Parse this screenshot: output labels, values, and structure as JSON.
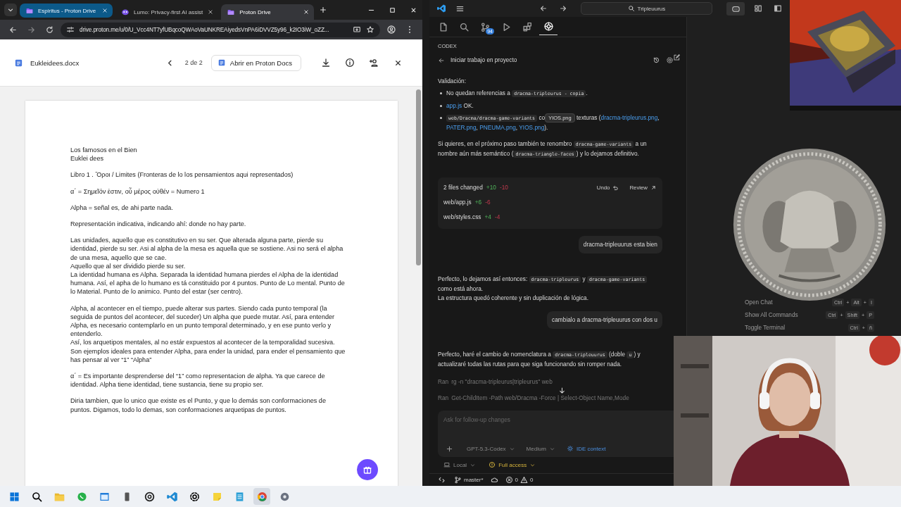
{
  "browser": {
    "tabs": [
      {
        "title": "Espiritus - Proton Drive",
        "selected": false,
        "hovered": true
      },
      {
        "title": "Lumo: Privacy-first AI assist",
        "selected": false,
        "hovered": false
      },
      {
        "title": "Proton Drive",
        "selected": true,
        "hovered": false
      }
    ],
    "address": "drive.proton.me/u/0/U_Vcc4NT7yfUBqcoQWAoVaUNKREAiyedsVnPA6iDVVZ5y96_k2IO3iW_oZZ...",
    "viewer": {
      "file_name": "Eukleidees.docx",
      "page_counter": "2 de 2",
      "open_button": "Abrir en Proton Docs"
    },
    "document": [
      [
        "Los famosos en el Bien",
        "Euklei dees"
      ],
      [
        "Libro 1 . Ὅροι / Limites (Fronteras de lo los pensamientos aqui representados)"
      ],
      [
        "α΄ = Σημεῖόν ἐστιν, οὗ μέρος οὐθέν = Numero 1"
      ],
      [
        "Alpha = señal es, de ahi parte nada."
      ],
      [
        "Representación indicativa, indicando ahí: donde no hay parte."
      ],
      [
        "Las unidades, aquello que es constitutivo en su ser. Que alterada alguna parte, pierde su identidad, pierde su ser. Asi al alpha de la mesa es aquella que se sostiene. Asi no será el alpha de una mesa, aquello que se cae.",
        "Aquello que al ser dividido pierde su ser.",
        "La identidad humana es Alpha. Separada la identidad humana pierdes el Alpha de la identidad humana. Así, el apha de lo humano es tá constituido por 4 puntos. Punto de Lo mental. Punto de lo Material. Punto de lo animico. Punto del estar (ser centro)."
      ],
      [
        "Alpha, al acontecer en el tiempo, puede alterar sus partes. Siendo cada punto temporal (la seguida de puntos del acontecer, del suceder) Un alpha que puede mutar. Así, para entender Alpha, es necesario contemplarlo en un punto temporal determinado, y en ese punto verlo y entenderlo.",
        "Así, los arquetipos mentales, al no estár expuestos al acontecer de la temporalidad sucesiva. Son ejemplos ideales para entender Alpha, para ender la unidad, para ender el pensamiento que has pensar al ver “1” “Alpha”"
      ],
      [
        "α΄ = Es importante desprenderse del “1” como representacion de alpha. Ya que carece de identidad. Alpha tiene identidad, tiene sustancia, tiene su propio ser."
      ],
      [
        "Diria tambien, que lo unico que existe es el Punto, y que lo demás son conformaciones de puntos. Digamos, todo lo demas, son conformaciones arquetipas de puntos."
      ]
    ]
  },
  "editor": {
    "search": "Tripleuurus",
    "activity": [
      {
        "selected": false
      },
      {
        "selected": false
      },
      {
        "selected": false,
        "badge": "94"
      },
      {
        "selected": false
      },
      {
        "selected": false
      },
      {
        "selected": true
      }
    ],
    "panel_title": "CODEX",
    "thread_title": "Iniciar trabajo en proyecto",
    "thread": [
      {
        "kind": "heading",
        "text": "Validación:"
      },
      {
        "kind": "bullets",
        "items": [
          [
            {
              "kind": "text",
              "text": "No quedan referencias a "
            },
            {
              "kind": "code",
              "text": "dracma-tripleurus - copia"
            },
            {
              "kind": "text",
              "text": "."
            }
          ],
          [
            {
              "kind": "link",
              "text": "app.js"
            },
            {
              "kind": "text",
              "text": " OK."
            }
          ],
          [
            {
              "kind": "code",
              "text": "web/Dracma/dracma-game-variants"
            },
            {
              "kind": "text",
              "text": " co"
            },
            {
              "kind": "tooltip",
              "text": "YIOS.png"
            },
            {
              "kind": "text",
              "text": " texturas ("
            },
            {
              "kind": "link",
              "text": "dracma-tripleurus.png"
            },
            {
              "kind": "text",
              "text": ", "
            },
            {
              "kind": "link",
              "text": "PATER.png"
            },
            {
              "kind": "text",
              "text": ", "
            },
            {
              "kind": "link",
              "text": "PNEUMA.png"
            },
            {
              "kind": "text",
              "text": ", "
            },
            {
              "kind": "link",
              "text": "YIOS.png"
            },
            {
              "kind": "text",
              "text": ")."
            }
          ]
        ]
      },
      {
        "kind": "paragraph",
        "lines": [
          [
            {
              "kind": "text",
              "text": "Si quieres, en el próximo paso también te renombro "
            },
            {
              "kind": "code",
              "text": "dracma-game-variants"
            },
            {
              "kind": "text",
              "text": " a un nombre aún más semántico ("
            },
            {
              "kind": "code",
              "text": "dracma-triangle-faces"
            },
            {
              "kind": "text",
              "text": ") y lo dejamos definitivo."
            }
          ]
        ]
      },
      {
        "kind": "changes",
        "summary": "2 files changed",
        "added": "+10",
        "removed": "-10",
        "undo": "Undo",
        "review": "Review",
        "files": [
          {
            "path": "web/app.js",
            "added": "+6",
            "removed": "-6"
          },
          {
            "path": "web/styles.css",
            "added": "+4",
            "removed": "-4"
          }
        ]
      },
      {
        "kind": "user",
        "text": "dracma-tripleuurus esta bien"
      },
      {
        "kind": "paragraph",
        "lines": [
          [
            {
              "kind": "text",
              "text": "Perfecto, lo dejamos así entonces: "
            },
            {
              "kind": "code",
              "text": "dracma-tripleurus"
            },
            {
              "kind": "text",
              "text": " y "
            },
            {
              "kind": "code",
              "text": "dracma-game-variants"
            },
            {
              "kind": "text",
              "text": " como está ahora."
            }
          ],
          [
            {
              "kind": "text",
              "text": "La estructura quedó coherente y sin duplicación de lógica."
            }
          ]
        ]
      },
      {
        "kind": "user",
        "text": "cambialo a dracma-tripleuurus con dos u"
      },
      {
        "kind": "paragraph",
        "lines": [
          [
            {
              "kind": "text",
              "text": "Perfecto, haré el cambio de nomenclatura a "
            },
            {
              "kind": "code",
              "text": "dracma-tripleuurus"
            },
            {
              "kind": "text",
              "text": " (doble "
            },
            {
              "kind": "code",
              "text": "u"
            },
            {
              "kind": "text",
              "text": ") y actualizaré todas las rutas para que siga funcionando sin romper nada."
            }
          ]
        ]
      },
      {
        "kind": "command",
        "label": "Ran",
        "text": "rg -n \"dracma-tripleurus|tripleurus\" web"
      },
      {
        "kind": "command",
        "label": "Ran",
        "text": "Get-ChildItem -Path web/Dracma -Force | Select-Object Name,Mode"
      }
    ],
    "composer": {
      "placeholder": "Ask for follow-up changes",
      "model": "GPT-5.3-Codex",
      "effort": "Medium",
      "context": "IDE context"
    },
    "environment": "Local",
    "access": "Full access",
    "status": {
      "branch": "master*",
      "errors": "0",
      "warnings": "0"
    },
    "key_separator": "+",
    "shortcuts": [
      {
        "label": "Open Chat",
        "keys": [
          "Ctrl",
          "Alt",
          "I"
        ]
      },
      {
        "label": "Show All Commands",
        "keys": [
          "Ctrl",
          "Shift",
          "P"
        ]
      },
      {
        "label": "Toggle Terminal",
        "keys": [
          "Ctrl",
          "ñ"
        ]
      }
    ]
  },
  "taskbar": [
    {
      "selected": false
    },
    {
      "selected": false
    },
    {
      "selected": false
    },
    {
      "selected": false
    },
    {
      "selected": false
    },
    {
      "selected": false
    },
    {
      "selected": false
    },
    {
      "selected": false
    },
    {
      "selected": false
    },
    {
      "selected": false
    },
    {
      "selected": false
    },
    {
      "selected": true
    },
    {
      "selected": false
    }
  ]
}
